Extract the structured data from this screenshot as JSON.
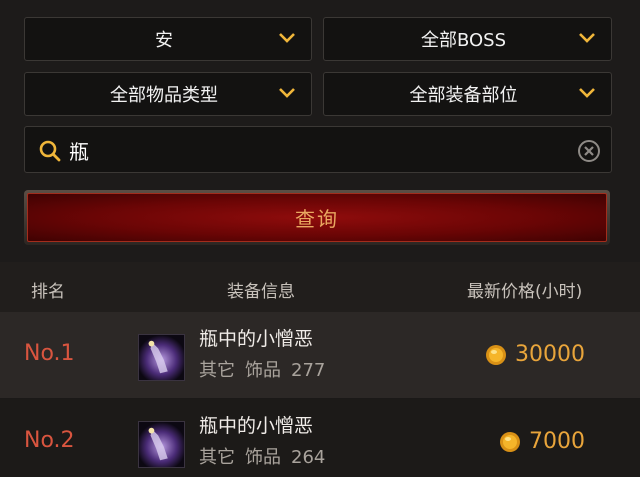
{
  "filters": {
    "server": "安",
    "boss": "全部BOSS",
    "item_type": "全部物品类型",
    "equip_slot": "全部装备部位"
  },
  "search": {
    "value": "瓶"
  },
  "query_button": "查询",
  "table": {
    "headers": {
      "rank": "排名",
      "info": "装备信息",
      "price": "最新价格(小时)"
    },
    "rows": [
      {
        "rank": "No.1",
        "name": "瓶中的小憎恶",
        "category": "其它",
        "type": "饰品",
        "level": "277",
        "price": "30000"
      },
      {
        "rank": "No.2",
        "name": "瓶中的小憎恶",
        "category": "其它",
        "type": "饰品",
        "level": "264",
        "price": "7000"
      }
    ]
  },
  "colors": {
    "accent": "#f0b63a",
    "rank": "#d9553f",
    "price": "#e9a53b",
    "button_bg": "#8f0c0c"
  }
}
